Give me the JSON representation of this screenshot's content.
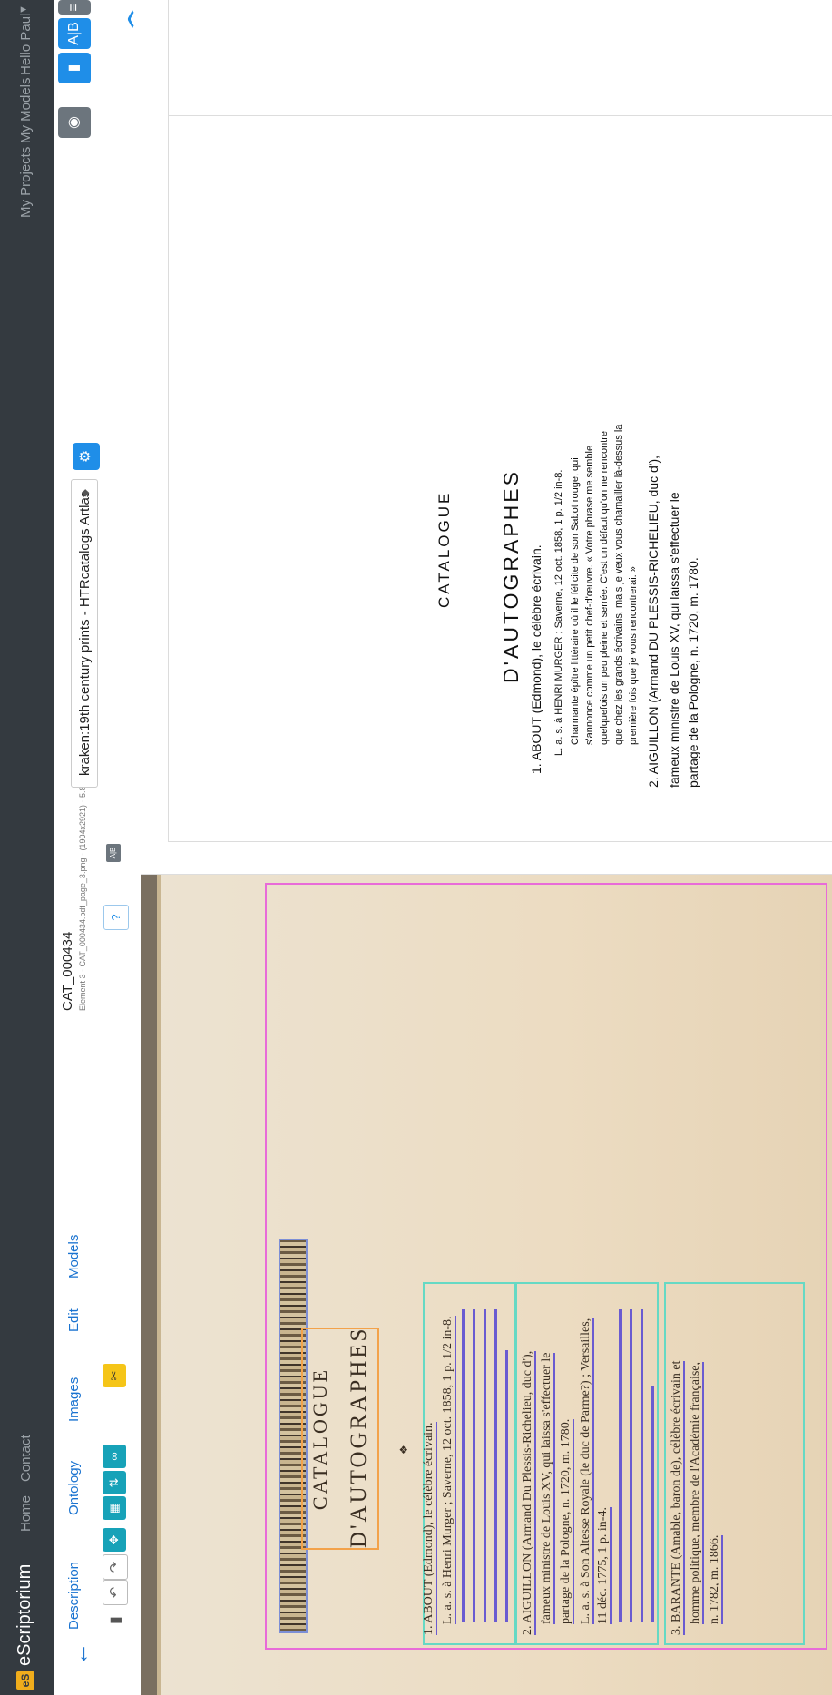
{
  "navbar": {
    "brand_logo": "eS",
    "brand": "eScriptorium",
    "links": [
      "Home",
      "Contact"
    ],
    "right_links": [
      "My Projects",
      "My Models",
      "Hello Paul"
    ]
  },
  "tabs": [
    "Description",
    "Ontology",
    "Images",
    "Edit",
    "Models"
  ],
  "document": {
    "title": "CAT_000434",
    "subtitle": "Element 3 - CAT_000434.pdf_page_3.png - (1904x2921) - 5.83MB"
  },
  "model_select": {
    "value": "kraken:19th century prints - HTRcatalogs Artlas"
  },
  "help_label": "?",
  "ab_label": "A|B",
  "icons": {
    "back": "arrow-left-icon",
    "gear": "gear-icon",
    "eye": "eye-icon",
    "chart": "bar-chart-icon",
    "ab": "ab-icon",
    "menu": "menu-icon",
    "undo": "undo-icon",
    "redo": "redo-icon",
    "scissors": "scissors-icon"
  },
  "scan": {
    "catalogue": "CATALOGUE",
    "autographes": "D'AUTOGRAPHES",
    "lines": [
      "1. ABOUT (Edmond), le célèbre écrivain.",
      "L. a. s. à Henri Murger ; Saverne, 12 oct. 1858, 1 p. 1/2 in-8.",
      "2. AIGUILLON (Armand Du Plessis-Richelieu, duc d'),",
      "fameux ministre de Louis XV, qui laissa s'effectuer le",
      "partage de la Pologne, n. 1720, m. 1780.",
      "L. a. s. à Son Altesse Royale (le duc de Parme?) ; Versailles,",
      "11 déc. 1775, 1 p. in-4.",
      "3. BARANTE (Amable, baron de), célèbre écrivain et",
      "homme politique, membre de l'Académie française,",
      "n. 1782, m. 1866."
    ]
  },
  "transcription": {
    "catalogue": "CATALOGUE",
    "autographes": "D'AUTOGRAPHES",
    "entry1": "1. ABOUT (Edmond), le célèbre écrivain.",
    "entry1_sub": "L. a. s. à HENRI MURGER ; Saverne, 12 oct. 1858, 1 p. 1/2 in-8.",
    "entry1_body": [
      "Charmante épître littéraire où il le félicite de son Sabot rouge, qui",
      "s'annonce comme un petit chef-d'œuvre. « Votre phrase me semble",
      "quelquefois un peu pleine et serrée. C'est un défaut qu'on ne rencontre",
      "que chez les grands écrivains, mais je veux vous chamailler là-dessus la",
      "première fois que je vous rencontrerai. »"
    ],
    "entry2": [
      "2. AIGUILLON (Armand DU PLESSIS-RICHELIEU, duc d'),",
      "fameux ministre de Louis XV, qui laissa s'effectuer le",
      "partage de la Pologne, n. 1720, m. 1780."
    ]
  },
  "colors": {
    "navbar": "#343a40",
    "primary": "#1f8ee8",
    "teal": "#17a2b8",
    "warning": "#f5c518",
    "region_magenta": "#e86bd8",
    "region_teal": "#66d9c4",
    "region_orange": "#f3a24a",
    "baseline": "#6a5bd1"
  }
}
